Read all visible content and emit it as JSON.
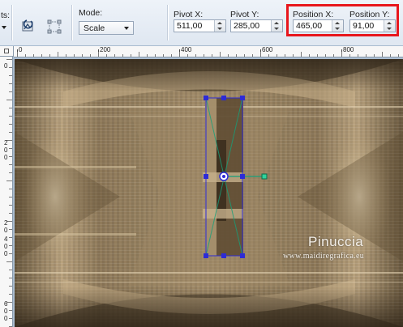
{
  "toolbar": {
    "partial_label": "ts:",
    "mode_label": "Mode:",
    "mode_value": "Scale",
    "pivot_x_label": "Pivot X:",
    "pivot_x_value": "511,00",
    "pivot_y_label": "Pivot Y:",
    "pivot_y_value": "285,00",
    "position_x_label": "Position X:",
    "position_x_value": "465,00",
    "position_y_label": "Position Y:",
    "position_y_value": "91,00",
    "highlight_color": "#e8161c"
  },
  "ruler": {
    "h_ticks": [
      "0",
      "200",
      "400",
      "600",
      "800"
    ],
    "v_ticks": [
      "0",
      "2",
      "0",
      "0",
      "2",
      "0",
      "4",
      "0",
      "0",
      "6",
      "0",
      "0"
    ]
  },
  "watermark": {
    "name": "Pinuccia",
    "site": "www.maidiregrafica.eu"
  }
}
